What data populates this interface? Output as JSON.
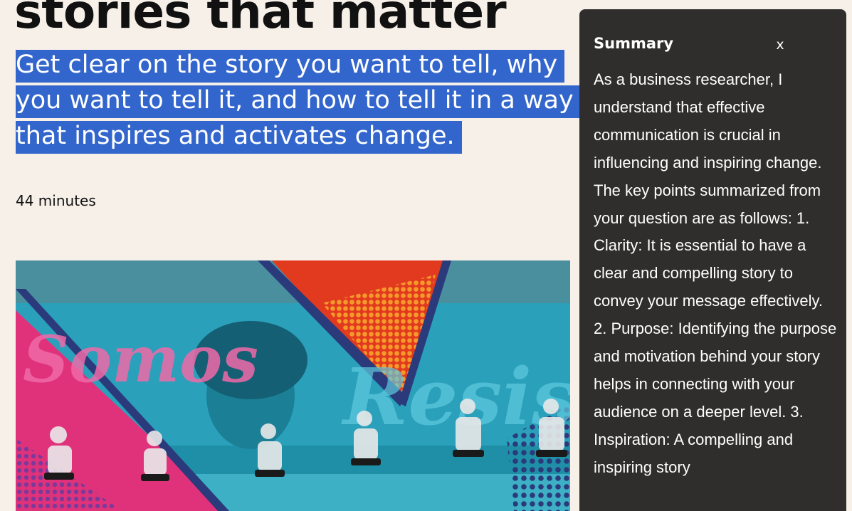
{
  "hero": {
    "title": "stories that matter",
    "subtitle": "Get clear on the story you want to tell, why you want to tell it, and how to tell it in a way that inspires and activates change.",
    "duration": "44 minutes"
  },
  "summary": {
    "title": "Summary",
    "close_label": "x",
    "body": "As a business researcher, I understand that effective communication is crucial in influencing and inspiring change. The key points summarized from your question are as follows: 1. Clarity: It is essential to have a clear and compelling story to convey your message effectively. 2. Purpose: Identifying the purpose and motivation behind your story helps in connecting with your audience on a deeper level. 3. Inspiration: A compelling and inspiring story"
  },
  "colors": {
    "page_background": "#f6f0e9",
    "selection_highlight": "#3366cc",
    "panel_background": "#2f2e2c",
    "image_teal": "#1f8fa8",
    "image_pink": "#e0327a",
    "image_orange": "#f07a1a",
    "image_navy": "#2a3a7a"
  },
  "image": {
    "subject": "duotone photo of people crouching in front of a graffiti mural"
  }
}
